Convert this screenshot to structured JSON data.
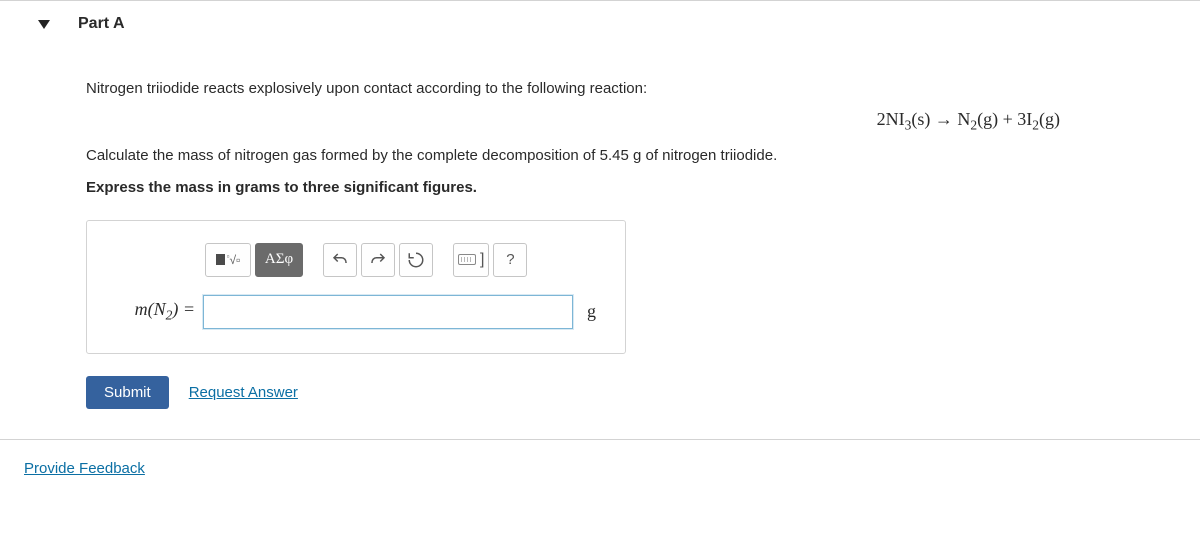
{
  "part": {
    "title": "Part A"
  },
  "question": {
    "intro": "Nitrogen triiodide reacts explosively upon contact according to the following reaction:",
    "reaction_html": "2NI<sub>3</sub>(s) → N<sub>2</sub>(g) + 3I<sub>2</sub>(g)",
    "calc": "Calculate the mass of nitrogen gas formed by the complete decomposition of 5.45 g of nitrogen triiodide.",
    "instr": "Express the mass in grams to three significant figures."
  },
  "toolbar": {
    "templates": "",
    "greek": "ΑΣφ",
    "undo": "undo-icon",
    "redo": "redo-icon",
    "reset": "reset-icon",
    "keyboard": "keyboard-icon",
    "help": "?"
  },
  "answer": {
    "var_html": "<i>m</i>(N<sub>2</sub>) =",
    "value": "",
    "unit": "g"
  },
  "actions": {
    "submit": "Submit",
    "request": "Request Answer"
  },
  "footer": {
    "feedback": "Provide Feedback"
  }
}
